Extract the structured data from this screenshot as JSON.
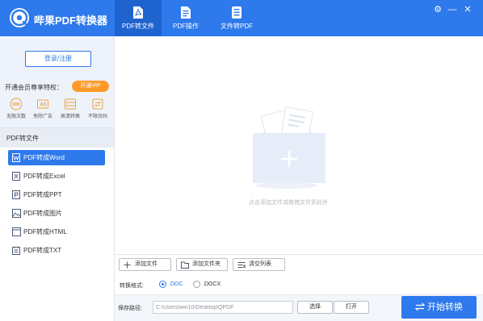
{
  "app": {
    "title": "哔果PDF转换器"
  },
  "tabs": [
    {
      "label": "PDF转文件",
      "icon": "pdf-icon",
      "active": true
    },
    {
      "label": "PDF操作",
      "icon": "pdf-operate-icon",
      "active": false
    },
    {
      "label": "文件转PDF",
      "icon": "file-to-pdf-icon",
      "active": false
    }
  ],
  "window_controls": {
    "settings": "⚙",
    "minimize": "—",
    "close": "✕"
  },
  "sidebar": {
    "login_label": "登录/注册",
    "vip_text": "开通会员尊享特权：",
    "vip_button": "开通VIP",
    "perks": [
      {
        "label": "无限次数",
        "icon": "infinity-icon"
      },
      {
        "label": "免除广告",
        "icon": "no-ads-icon"
      },
      {
        "label": "高清转换",
        "icon": "hd-convert-icon"
      },
      {
        "label": "不限页码",
        "icon": "unlimited-pages-icon"
      }
    ],
    "section_title": "PDF转文件",
    "items": [
      {
        "label": "PDF转成Word",
        "icon": "word-icon",
        "active": true
      },
      {
        "label": "PDF转成Excel",
        "icon": "excel-icon",
        "active": false
      },
      {
        "label": "PDF转成PPT",
        "icon": "ppt-icon",
        "active": false
      },
      {
        "label": "PDF转成图片",
        "icon": "image-icon",
        "active": false
      },
      {
        "label": "PDF转成HTML",
        "icon": "html-icon",
        "active": false
      },
      {
        "label": "PDF转成TXT",
        "icon": "txt-icon",
        "active": false
      }
    ]
  },
  "main": {
    "drop_hint": "点击添加文件或拖拽文件到此外",
    "toolbar": {
      "add_file": "添加文件",
      "add_folder": "添加文件夹",
      "clear_list": "清空列表"
    },
    "format": {
      "label": "转换格式:",
      "options": [
        {
          "label": ".DOC",
          "checked": true
        },
        {
          "label": ".DOCX",
          "checked": false
        }
      ]
    },
    "save_path": {
      "label": "保存路径:",
      "value": "C:\\Users\\win10\\Desktop\\QPDF",
      "choose_button": "选择",
      "open_button": "打开"
    },
    "start_button": "开始转换"
  },
  "colors": {
    "accent": "#2e79ec",
    "vip": "#ff9a2a",
    "sidebar_bg": "#eef3fb"
  }
}
